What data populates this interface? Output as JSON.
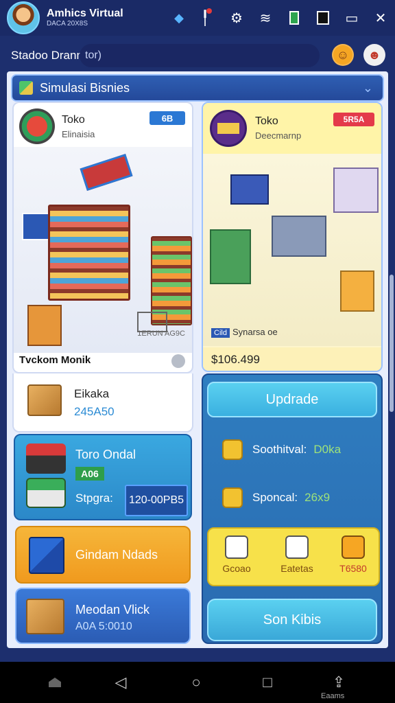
{
  "header": {
    "app_title": "Amhics Virtual",
    "app_subtitle": "DACA 20X8S",
    "icons": [
      "diamond-icon",
      "location-pin-icon",
      "signal-icon",
      "wifi-icon",
      "battery-green-icon",
      "battery-black-icon",
      "window-icon",
      "close-icon"
    ]
  },
  "subbar": {
    "label": "Stadoo Drann",
    "field_value": "tor)"
  },
  "section": {
    "title": "Simulasi Bisnies"
  },
  "left_shop": {
    "title": "Toko",
    "subtitle": "Elinaisia",
    "badge": "6B",
    "caption": "1ERUN AG9C",
    "name": "Tvckom Monik"
  },
  "stock": {
    "title": "Eikaka",
    "value": "245A50"
  },
  "order": {
    "title": "Toro Ondal",
    "tag": "A06",
    "label": "Stpgra:",
    "price": "120-00PB5"
  },
  "orange_button": {
    "label": "Gindam Ndads"
  },
  "blue_button": {
    "title": "Meodan Vlick",
    "value": "A0A 5:0010"
  },
  "right_shop": {
    "title": "Toko",
    "subtitle": "Deecmarnp",
    "badge": "5R5A",
    "caption_tag": "Cild",
    "caption": "Synarsa oe",
    "price": "$106.499"
  },
  "right_stats": {
    "upgrade_label": "Updrade",
    "stat1_label": "Soothitval:",
    "stat1_value": "D0ka",
    "stat2_label": "Sponcal:",
    "stat2_value": "26x9",
    "mini1": "Gcoao",
    "mini2": "Eatetas",
    "mini3": "T6580",
    "sell_label": "Son Kibis"
  },
  "bottom_nav": {
    "share_label": "Eaams"
  }
}
